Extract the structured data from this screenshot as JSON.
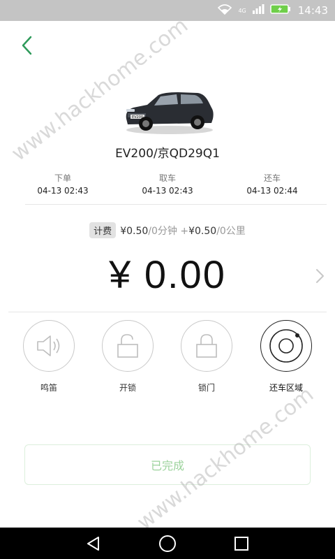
{
  "status_bar": {
    "network": "4G",
    "time": "14:43"
  },
  "header": {
    "back_icon": "chevron-left-icon"
  },
  "vehicle": {
    "title": "EV200/京QD29Q1",
    "plate_sticker": "EV200"
  },
  "order_times": [
    {
      "label": "下单",
      "value": "04-13 02:43"
    },
    {
      "label": "取车",
      "value": "04-13 02:43"
    },
    {
      "label": "还车",
      "value": "04-13 02:44"
    }
  ],
  "fee": {
    "badge": "计费",
    "minute_price": "¥0.50",
    "minute_unit": "/0分钟",
    "plus": "+",
    "km_price": "¥0.50",
    "km_unit": "/0公里"
  },
  "amount": "¥ 0.00",
  "actions": [
    {
      "label": "鸣笛",
      "icon": "horn-icon"
    },
    {
      "label": "开锁",
      "icon": "unlock-icon"
    },
    {
      "label": "锁门",
      "icon": "lock-icon"
    },
    {
      "label": "还车区域",
      "icon": "return-area-icon"
    }
  ],
  "done_button": "已完成",
  "watermark": "www.hackhome.com",
  "colors": {
    "accent_green": "#2e9a5a",
    "done_text": "#9cd39c"
  }
}
